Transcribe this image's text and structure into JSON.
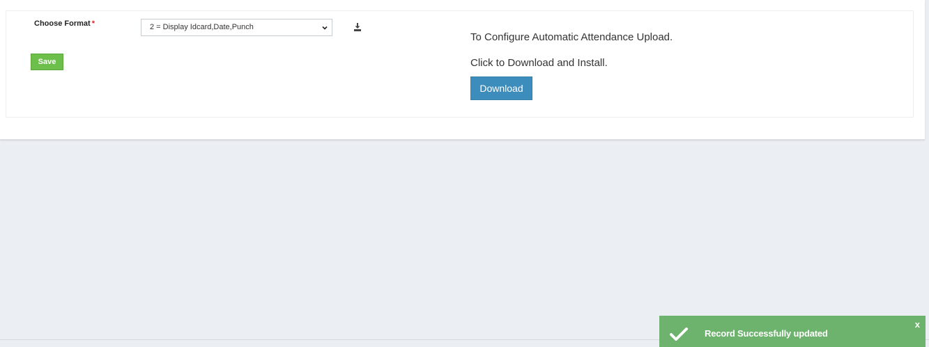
{
  "form": {
    "format_label": "Choose Format",
    "required_mark": "*",
    "format_selected": "2 = Display Idcard,Date,Punch",
    "save_label": "Save"
  },
  "config": {
    "configure_text": "To Configure Automatic Attendance Upload.",
    "click_text": "Click to Download and Install.",
    "download_label": "Download"
  },
  "toast": {
    "message": "Record Successfully updated",
    "close_label": "x",
    "color": "#6db36e"
  },
  "icons": {
    "select_chevron": "chevron-down-icon",
    "download": "download-icon",
    "toast_check": "check-icon"
  },
  "colors": {
    "save_button": "#6cbf4a",
    "download_button": "#3c8dbc",
    "required": "#d9262b",
    "background": "#ebeef2"
  }
}
